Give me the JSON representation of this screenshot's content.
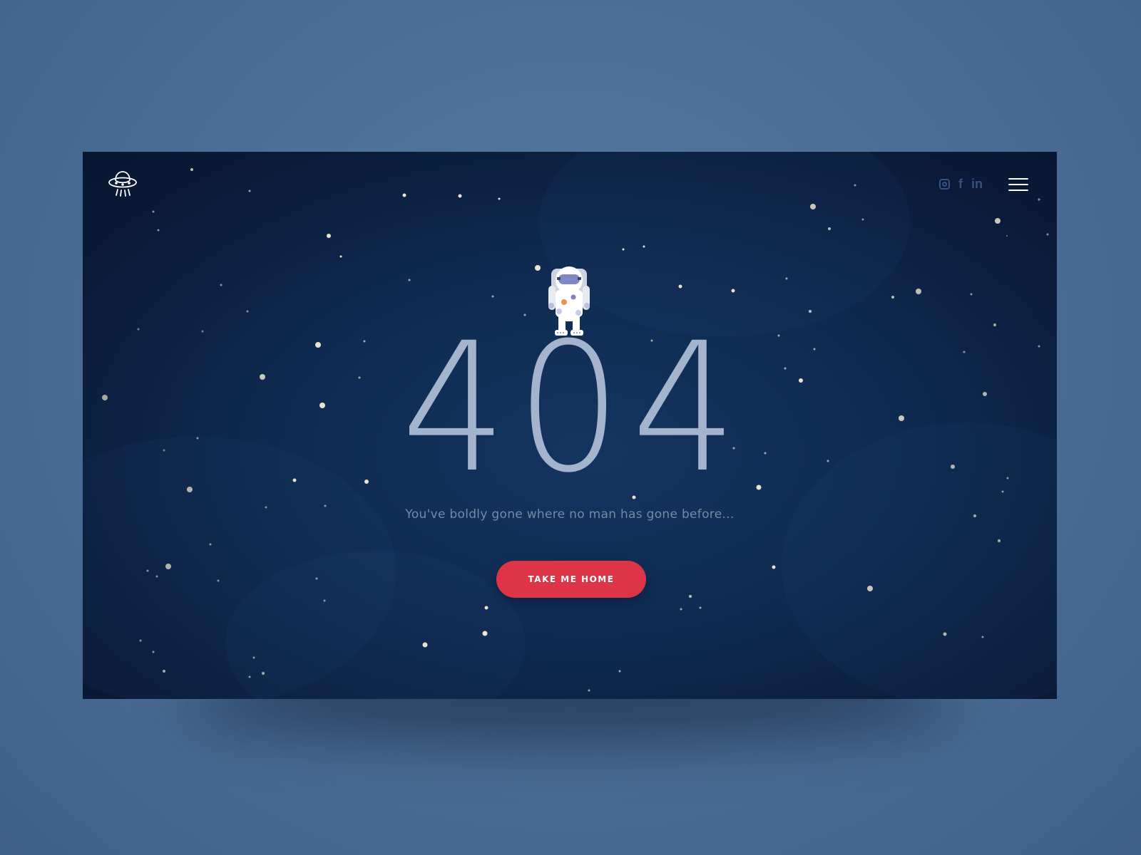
{
  "brand": {
    "icon": "ufo-icon"
  },
  "social": [
    {
      "name": "instagram",
      "icon": "instagram-icon",
      "glyph": ""
    },
    {
      "name": "facebook",
      "icon": "facebook-icon",
      "glyph": "f"
    },
    {
      "name": "linkedin",
      "icon": "linkedin-icon",
      "glyph": "in"
    }
  ],
  "menu": {
    "icon": "hamburger-menu-icon"
  },
  "error": {
    "code_digits": [
      "4",
      "0",
      "4"
    ],
    "message": "You've boldly gone where no man has gone before..."
  },
  "cta": {
    "label": "TAKE ME HOME"
  },
  "colors": {
    "page_background": "#4d6f97",
    "frame_background": "#0f2a50",
    "digit_color": "#a4b4cc",
    "message_color": "#7689a8",
    "button_color": "#dd3448",
    "social_icon_color": "#35527f",
    "star_color": "#e9e4cf"
  }
}
